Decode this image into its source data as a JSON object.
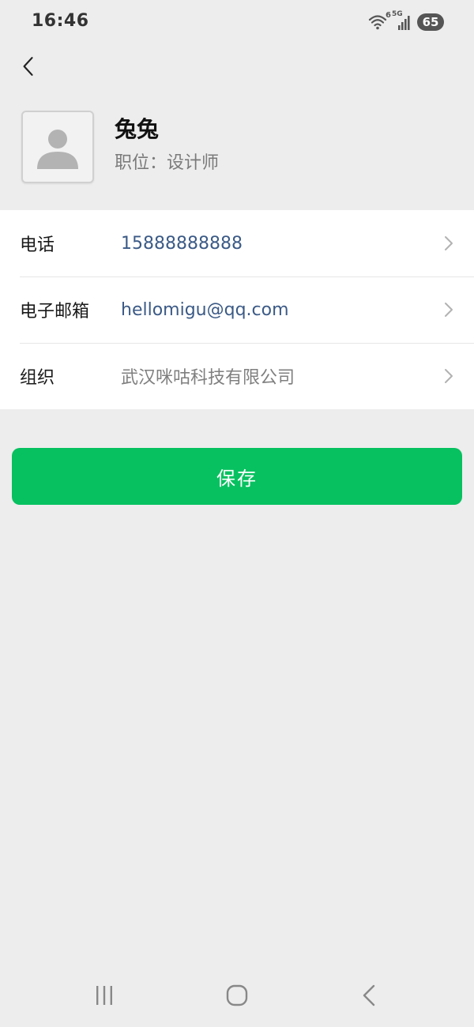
{
  "status_bar": {
    "time": "16:46",
    "wifi_badge": "6",
    "network": "5G",
    "battery": "65"
  },
  "profile": {
    "name": "兔兔",
    "position": "职位：设计师"
  },
  "info": [
    {
      "label": "电话",
      "value": "15888888888"
    },
    {
      "label": "电子邮箱",
      "value": "hellomigu@qq.com"
    },
    {
      "label": "组织",
      "value": "武汉咪咕科技有限公司"
    }
  ],
  "actions": {
    "save_label": "保存"
  },
  "colors": {
    "background": "#ededed",
    "primary_green": "#07c160",
    "link_blue": "#3b5a86",
    "muted_text": "#7f7f7f"
  },
  "icons": {
    "back": "back-arrow-icon",
    "avatar": "person-silhouette-icon",
    "chevron": "chevron-right-icon",
    "recent_apps": "recent-apps-icon",
    "home": "home-icon",
    "system_back": "system-back-icon"
  }
}
